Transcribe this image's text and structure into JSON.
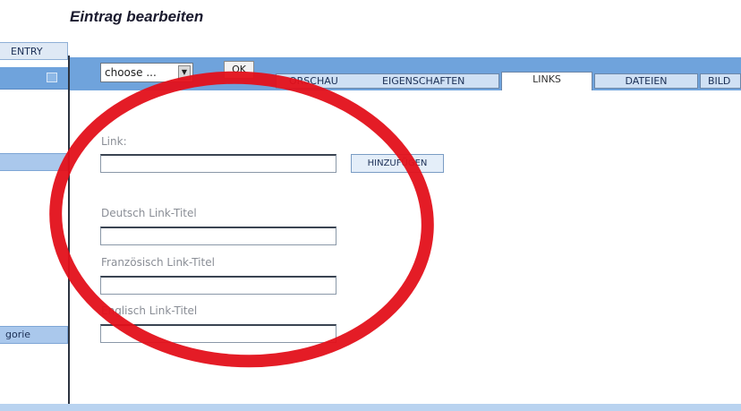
{
  "page": {
    "title": "Eintrag bearbeiten"
  },
  "sidebar": {
    "entry_tab": "ENTRY",
    "items": [
      {
        "label": ""
      },
      {
        "label": "gorie"
      }
    ]
  },
  "toolbar": {
    "select_value": "choose ...",
    "ok_label": "OK",
    "tabs": [
      {
        "label": "ORSCHAU"
      },
      {
        "label": "EIGENSCHAFTEN"
      },
      {
        "label": "LINKS",
        "active": true
      },
      {
        "label": "DATEIEN"
      },
      {
        "label": "BILD"
      }
    ]
  },
  "form": {
    "link_label": "Link:",
    "link_value": "",
    "add_button": "HINZUFÜGEN",
    "title_de_label": "Deutsch Link-Titel",
    "title_fr_label": "Französisch Link-Titel",
    "title_en_label": "Englisch Link-Titel"
  },
  "colors": {
    "toolbar_blue": "#6fa3dc",
    "sidebar_item": "#aac8ec",
    "annotation_red": "#e3101a"
  }
}
